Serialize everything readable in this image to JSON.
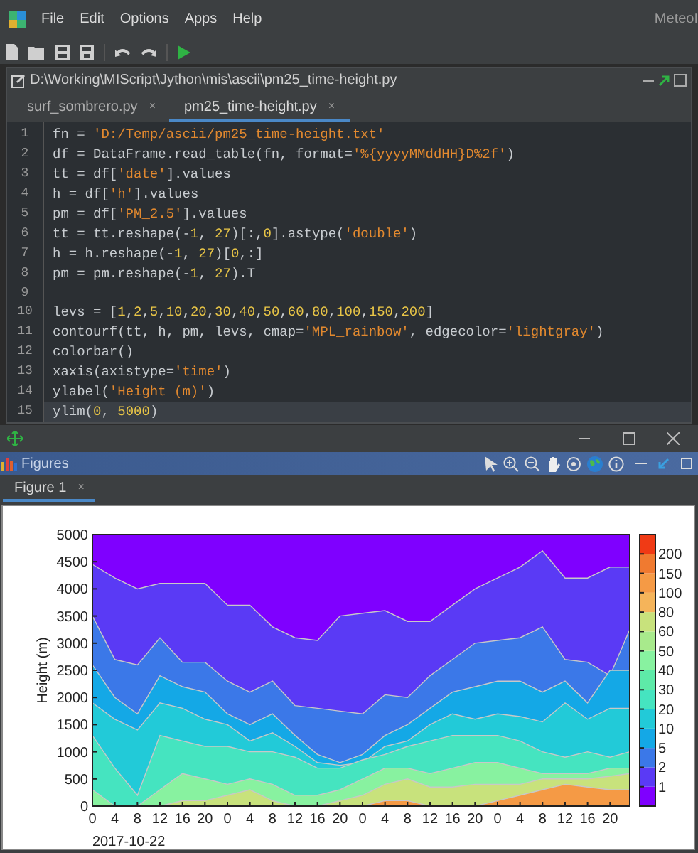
{
  "menu_bar": {
    "items": [
      "File",
      "Edit",
      "Options",
      "Apps",
      "Help"
    ],
    "app_title": "MeteoI"
  },
  "editor": {
    "path": "D:\\Working\\MIScript\\Jython\\mis\\ascii\\pm25_time-height.py",
    "tabs": [
      {
        "label": "surf_sombrero.py",
        "close": "×",
        "selected": false
      },
      {
        "label": "pm25_time-height.py",
        "close": "×",
        "selected": true
      }
    ],
    "lines": [
      {
        "number": "1",
        "code": "fn = 'D:/Temp/ascii/pm25_time-height.txt'",
        "current": false
      },
      {
        "number": "2",
        "code": "df = DataFrame.read_table(fn, format='%{yyyyMMddHH}D%2f')",
        "current": false
      },
      {
        "number": "3",
        "code": "tt = df['date'].values",
        "current": false
      },
      {
        "number": "4",
        "code": "h = df['h'].values",
        "current": false
      },
      {
        "number": "5",
        "code": "pm = df['PM_2.5'].values",
        "current": false
      },
      {
        "number": "6",
        "code": "tt = tt.reshape(-1, 27)[:,0].astype('double')",
        "current": false
      },
      {
        "number": "7",
        "code": "h = h.reshape(-1, 27)[0,:]",
        "current": false
      },
      {
        "number": "8",
        "code": "pm = pm.reshape(-1, 27).T",
        "current": false
      },
      {
        "number": "9",
        "current": false
      },
      {
        "number": "10",
        "code": "levs = [1,2,5,10,20,30,40,50,60,80,100,150,200]",
        "current": false
      },
      {
        "number": "11",
        "code": "contourf(tt, h, pm, levs, cmap='MPL_rainbow', edgecolor='lightgray')",
        "current": false
      },
      {
        "number": "12",
        "code": "colorbar()",
        "current": false
      },
      {
        "number": "13",
        "code": "xaxis(axistype='time')",
        "current": false
      },
      {
        "number": "14",
        "code": "ylabel('Height (m)')",
        "current": false
      },
      {
        "number": "15",
        "code": "ylim(0, 5000)",
        "current": true
      }
    ]
  },
  "figures": {
    "title": "Figures",
    "tabs": [
      {
        "label": "Figure 1",
        "close": "×",
        "selected": true
      }
    ],
    "plot": {
      "ylabel": "Height (m)",
      "yticks": [
        "5000",
        "4500",
        "4000",
        "3500",
        "3000",
        "2500",
        "2000",
        "1500",
        "1000",
        "500",
        "0"
      ],
      "xticks": [
        "0",
        "4",
        "8",
        "12",
        "16",
        "20",
        "0",
        "4",
        "8",
        "12",
        "16",
        "20",
        "0",
        "4",
        "8",
        "12",
        "16",
        "20",
        "0",
        "4",
        "8",
        "12",
        "16",
        "20"
      ],
      "date_label": "2017-10-22",
      "colorbar_labels": [
        "200",
        "150",
        "100",
        "80",
        "60",
        "50",
        "40",
        "30",
        "20",
        "10",
        "5",
        "2",
        "1"
      ]
    }
  }
}
